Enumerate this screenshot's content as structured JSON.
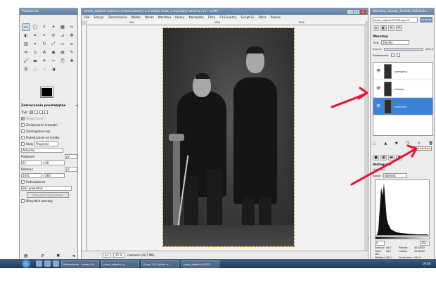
{
  "toolbox": {
    "title": "Przybornik",
    "tool_icons": [
      "rect-select",
      "ellipse-select",
      "free-select",
      "fuzzy-select",
      "color-select",
      "scissors-select",
      "foreground-select",
      "paths",
      "color-picker",
      "zoom",
      "measure",
      "move",
      "align",
      "crop",
      "rotate",
      "scale",
      "shear",
      "perspective",
      "flip",
      "cage",
      "text",
      "bucket-fill",
      "blend",
      "pencil",
      "paintbrush",
      "eraser",
      "airbrush",
      "ink",
      "clone",
      "heal",
      "perspective-clone",
      "blur",
      "smudge",
      "dodge-burn"
    ],
    "options_title": "Zaznaczanie prostokątne",
    "mode_label": "Tryb:",
    "antialias_label": "Wygładzanie",
    "feather_label": "Zmiękczanie krawędzi",
    "rounded_label": "Zaokrąglone rogi",
    "expand_label": "Powiększanie od środka",
    "fixed_label": "Stały",
    "fixed_value": "Proporcje",
    "current_value": "Aktualny",
    "position_label": "Położenie:",
    "position_unit": "px",
    "position_x": "21",
    "position_y": "48",
    "size_label": "Rozmiar:",
    "size_unit": "px",
    "size_w": "1441",
    "size_h": "380",
    "highlight_label": "Podświetlenie",
    "guides_value": "Bez prowadnic",
    "shrink_button": "Zmniejsz zaznaczenie",
    "merge_label": "Wszystkie warstwy"
  },
  "image_window": {
    "title": "[stare_zdjecie-rodzina] (importowany)-1.0 (Kolor RGB, 3 warstwy) 1181x1773 – GIMP",
    "menu": [
      "Plik",
      "Edycja",
      "Zaznaczenie",
      "Widok",
      "Obraz",
      "Warstwa",
      "Kolory",
      "Narzędzia",
      "Filtry",
      "FX-Foundry",
      "Script-Fu",
      "Okna",
      "Pomoc"
    ],
    "ruler_marks": [
      "500",
      "1000",
      "1500"
    ],
    "status_unit": "px",
    "status_zoom": "25 %",
    "status_text": "niebieski (43,7 MB)"
  },
  "dock": {
    "title": "Warstwy, Kanały, Ścieżki, Cofnięcie...",
    "image_select": "stare_zdjecie-RODZ.jpg-13",
    "auto_button": "Automat.",
    "layers_title": "Warstwy",
    "mode_label": "Tryb:",
    "mode_value": "Zwykły",
    "opacity_label": "Krycie:",
    "opacity_value": "100,0",
    "lock_label": "Blokowanie:",
    "layers": [
      {
        "name": "czerwony",
        "selected": false
      },
      {
        "name": "zielony",
        "selected": false
      },
      {
        "name": "niebieski",
        "selected": true
      }
    ],
    "histogram_title": "Histogram",
    "histogram_sub": "niebieski",
    "channel_label": "Kanał:",
    "channel_value": "Wartość",
    "range_min": "0",
    "range_max": "255",
    "stats": [
      [
        "Średnia:",
        "46,1",
        "Piksele:",
        "4022802"
      ],
      [
        "Odch. std.:",
        "26,1",
        "Liczba:",
        "4022802"
      ],
      [
        "Mediana:",
        "30,0",
        "Centyl proc.:",
        "100,0"
      ]
    ],
    "tooltip": "Usuń warstwę"
  },
  "taskbar": {
    "tasks": [
      "Wskazówka – zadań Wi...",
      "stare_zdjecie-ro...",
      "B.jpg-13.0 (Kolor p...",
      "stare_zdjecie-RODZ..."
    ],
    "clock": "19:08"
  },
  "colors": {
    "titlebar": "#5d7fa2",
    "selection": "#3c82d8",
    "arrow": "#e8113a"
  }
}
